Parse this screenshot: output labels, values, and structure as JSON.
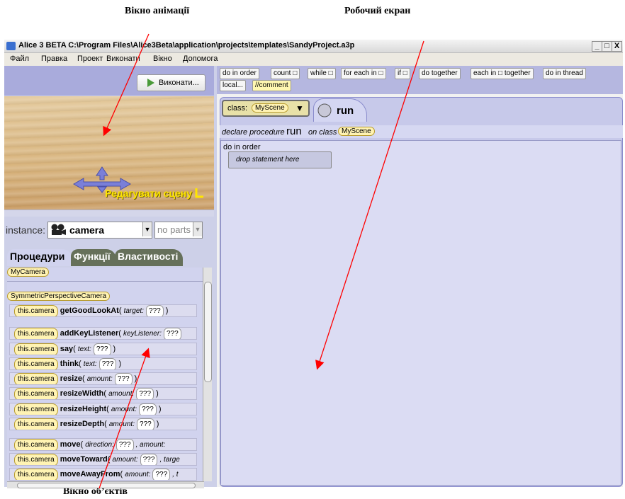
{
  "captions": {
    "animation": "Вікно анімації",
    "workspace": "Робочий екран",
    "objects": "Вікно об’єктів"
  },
  "window": {
    "title": "Alice 3 BETA  C:\\Program Files\\Alice3Beta\\application\\projects\\templates\\SandyProject.a3p",
    "controls": [
      "_",
      "□",
      "X"
    ]
  },
  "menu": [
    "Файл",
    "Правка",
    "Проект",
    "Виконати",
    "Вікно",
    "Допомога"
  ],
  "scene": {
    "run_button": "Виконати...",
    "edit_scene": "Редагувати сцену"
  },
  "instance": {
    "label": "instance:",
    "selected": "camera",
    "parts": "no parts"
  },
  "tabs": [
    "Процедури",
    "Функції",
    "Властивості"
  ],
  "types": {
    "own": "MyCamera",
    "parent": "SymmetricPerspectiveCamera"
  },
  "procedures": [
    {
      "target": "this.camera",
      "name": "getGoodLookAt",
      "params": "target:",
      "value": "???"
    },
    {
      "target": "this.camera",
      "name": "addKeyListener",
      "params": "keyListener:",
      "value": "???"
    },
    {
      "target": "this.camera",
      "name": "say",
      "params": "text:",
      "value": "???"
    },
    {
      "target": "this.camera",
      "name": "think",
      "params": "text:",
      "value": "???"
    },
    {
      "target": "this.camera",
      "name": "resize",
      "params": "amount:",
      "value": "???"
    },
    {
      "target": "this.camera",
      "name": "resizeWidth",
      "params": "amount:",
      "value": "???"
    },
    {
      "target": "this.camera",
      "name": "resizeHeight",
      "params": "amount:",
      "value": "???"
    },
    {
      "target": "this.camera",
      "name": "resizeDepth",
      "params": "amount:",
      "value": "???"
    },
    {
      "target": "this.camera",
      "name": "move",
      "params": "direction:",
      "value": "???",
      "extra": ", amount:"
    },
    {
      "target": "this.camera",
      "name": "moveToward",
      "params": "amount:",
      "value": "???",
      "extra": ", targe"
    },
    {
      "target": "this.camera",
      "name": "moveAwayFrom",
      "params": "amount:",
      "value": "???",
      "extra": ", t"
    }
  ],
  "control_flow": [
    "do in order",
    "count □",
    "while □",
    "for each in □",
    "if □",
    "do together",
    "each in □ together",
    "do in thread",
    "local...",
    "//comment"
  ],
  "editor": {
    "class_label": "class:",
    "class_name": "MyScene",
    "tab": "run",
    "declare_prefix": "declare procedure",
    "proc_name": "run",
    "on_class": "on class",
    "class_chip": "MyScene",
    "block": "do in order",
    "drop_hint": "drop statement here"
  }
}
